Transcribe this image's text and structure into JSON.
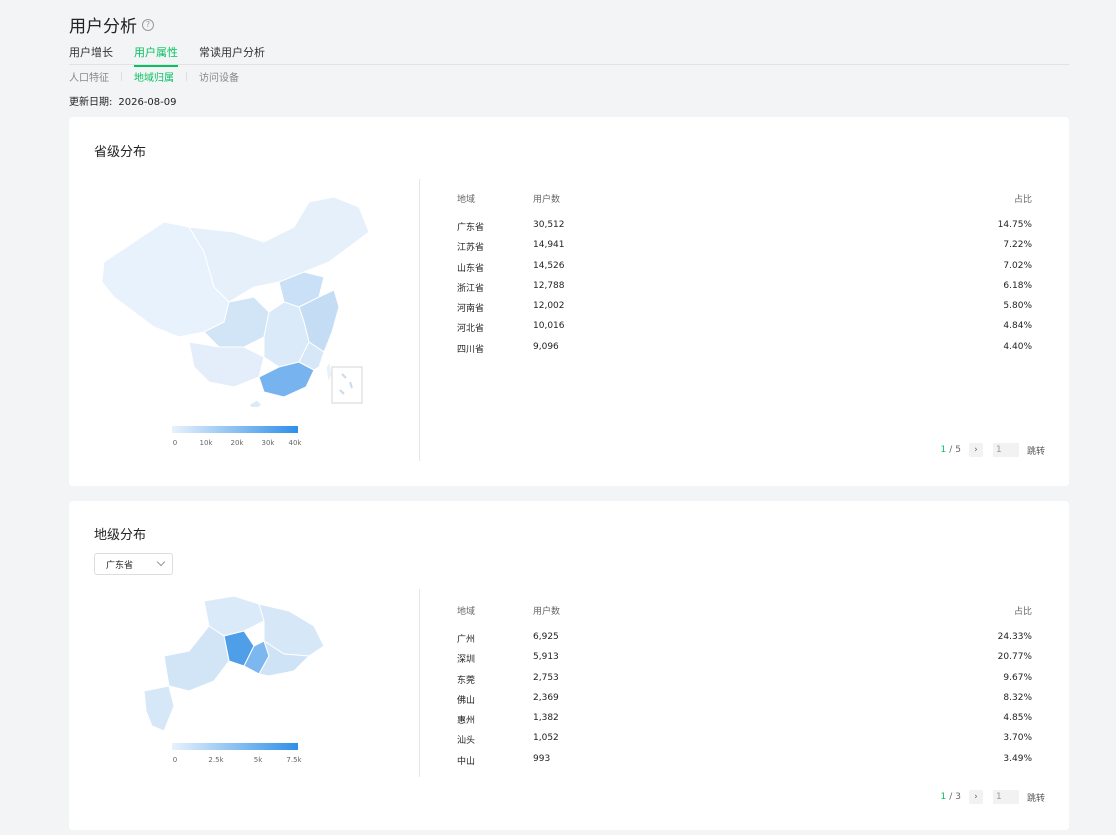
{
  "page": {
    "title": "用户分析",
    "help_icon": "question-circle-icon"
  },
  "tabs": [
    {
      "label": "用户增长",
      "active": false
    },
    {
      "label": "用户属性",
      "active": true
    },
    {
      "label": "常读用户分析",
      "active": false
    }
  ],
  "subtabs": [
    {
      "label": "人口特征",
      "active": false
    },
    {
      "label": "地域归属",
      "active": true
    },
    {
      "label": "访问设备",
      "active": false
    }
  ],
  "update": {
    "label": "更新日期:",
    "value": "2026-08-09"
  },
  "colors": {
    "accent": "#07c160",
    "map_low": "#e8f2fc",
    "map_high": "#2e8fe8"
  },
  "province": {
    "title": "省级分布",
    "legend": {
      "ticks": [
        "0",
        "10k",
        "20k",
        "30k",
        "40k"
      ],
      "max": 40000
    },
    "table": {
      "headers": {
        "region": "地域",
        "users": "用户数",
        "ratio": "占比"
      },
      "rows": [
        {
          "region": "广东省",
          "users": "30,512",
          "ratio": "14.75%"
        },
        {
          "region": "江苏省",
          "users": "14,941",
          "ratio": "7.22%"
        },
        {
          "region": "山东省",
          "users": "14,526",
          "ratio": "7.02%"
        },
        {
          "region": "浙江省",
          "users": "12,788",
          "ratio": "6.18%"
        },
        {
          "region": "河南省",
          "users": "12,002",
          "ratio": "5.80%"
        },
        {
          "region": "河北省",
          "users": "10,016",
          "ratio": "4.84%"
        },
        {
          "region": "四川省",
          "users": "9,096",
          "ratio": "4.40%"
        }
      ]
    },
    "pager": {
      "current": "1",
      "total": "5",
      "input": "1",
      "jump": "跳转",
      "next_icon": "chevron-right-icon"
    }
  },
  "city": {
    "title": "地级分布",
    "select": {
      "value": "广东省",
      "icon": "chevron-down-icon"
    },
    "legend": {
      "ticks": [
        "0",
        "2.5k",
        "5k",
        "7.5k"
      ],
      "max": 7500
    },
    "table": {
      "headers": {
        "region": "地域",
        "users": "用户数",
        "ratio": "占比"
      },
      "rows": [
        {
          "region": "广州",
          "users": "6,925",
          "ratio": "24.33%"
        },
        {
          "region": "深圳",
          "users": "5,913",
          "ratio": "20.77%"
        },
        {
          "region": "东莞",
          "users": "2,753",
          "ratio": "9.67%"
        },
        {
          "region": "佛山",
          "users": "2,369",
          "ratio": "8.32%"
        },
        {
          "region": "惠州",
          "users": "1,382",
          "ratio": "4.85%"
        },
        {
          "region": "汕头",
          "users": "1,052",
          "ratio": "3.70%"
        },
        {
          "region": "中山",
          "users": "993",
          "ratio": "3.49%"
        }
      ]
    },
    "pager": {
      "current": "1",
      "total": "3",
      "input": "1",
      "jump": "跳转",
      "next_icon": "chevron-right-icon"
    }
  }
}
